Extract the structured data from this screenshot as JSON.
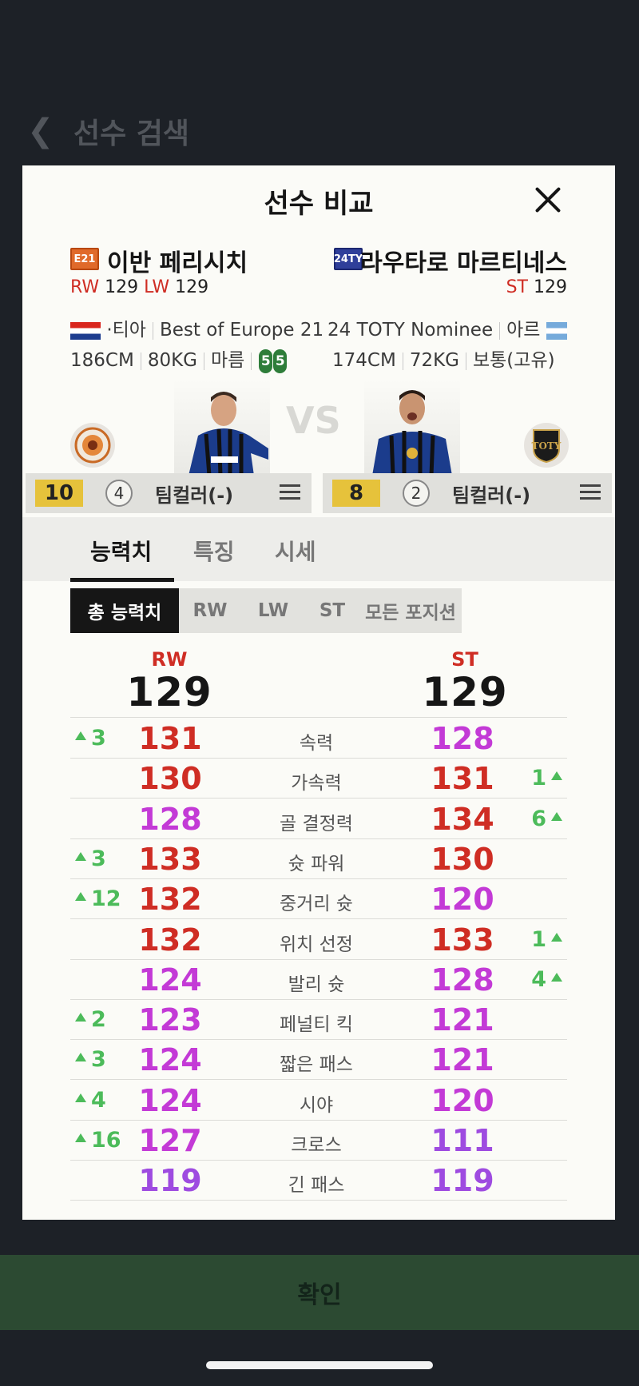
{
  "background": {
    "back_icon": "chevron-left-icon",
    "title": "선수 검색",
    "confirm_label": "확인"
  },
  "modal": {
    "title": "선수 비교",
    "close_icon": "close-icon",
    "vs": "VS"
  },
  "left_player": {
    "season_badge": "E21",
    "name": "이반 페리시치",
    "positions": [
      {
        "pos": "RW",
        "ovr": "129"
      },
      {
        "pos": "LW",
        "ovr": "129"
      }
    ],
    "nation_suffix": "·티아",
    "season_name": "Best of Europe 21",
    "height": "186CM",
    "weight": "80KG",
    "body_type": "마름",
    "skill_moves": [
      "5",
      "5"
    ],
    "grade": "10",
    "enhance": "4",
    "team_color": "팀컬러(-)"
  },
  "right_player": {
    "season_badge": "24TY",
    "name": "라우타로 마르티네스",
    "positions": [
      {
        "pos": "ST",
        "ovr": "129"
      }
    ],
    "season_name": "24 TOTY Nominee",
    "nation_prefix": "아르",
    "height": "174CM",
    "weight": "72KG",
    "body_type": "보통(고유)",
    "grade": "8",
    "enhance": "2",
    "team_color": "팀컬러(-)"
  },
  "tabs": [
    "능력치",
    "특징",
    "시세"
  ],
  "segments": [
    "총 능력치",
    "RW",
    "LW",
    "ST",
    "모든 포지션"
  ],
  "overall": {
    "left_pos": "RW",
    "left_val": "129",
    "right_pos": "ST",
    "right_val": "129"
  },
  "stats": [
    {
      "name": "속력",
      "left": "131",
      "right": "128",
      "left_diff": "3",
      "right_diff": "",
      "lc": "red",
      "rc": "mag"
    },
    {
      "name": "가속력",
      "left": "130",
      "right": "131",
      "left_diff": "",
      "right_diff": "1",
      "lc": "red",
      "rc": "red"
    },
    {
      "name": "골 결정력",
      "left": "128",
      "right": "134",
      "left_diff": "",
      "right_diff": "6",
      "lc": "mag",
      "rc": "red"
    },
    {
      "name": "슛 파워",
      "left": "133",
      "right": "130",
      "left_diff": "3",
      "right_diff": "",
      "lc": "red",
      "rc": "red"
    },
    {
      "name": "중거리 슛",
      "left": "132",
      "right": "120",
      "left_diff": "12",
      "right_diff": "",
      "lc": "red",
      "rc": "mag"
    },
    {
      "name": "위치 선정",
      "left": "132",
      "right": "133",
      "left_diff": "",
      "right_diff": "1",
      "lc": "red",
      "rc": "red"
    },
    {
      "name": "발리 슛",
      "left": "124",
      "right": "128",
      "left_diff": "",
      "right_diff": "4",
      "lc": "mag",
      "rc": "mag"
    },
    {
      "name": "페널티 킥",
      "left": "123",
      "right": "121",
      "left_diff": "2",
      "right_diff": "",
      "lc": "mag",
      "rc": "mag"
    },
    {
      "name": "짧은 패스",
      "left": "124",
      "right": "121",
      "left_diff": "3",
      "right_diff": "",
      "lc": "mag",
      "rc": "mag"
    },
    {
      "name": "시야",
      "left": "124",
      "right": "120",
      "left_diff": "4",
      "right_diff": "",
      "lc": "mag",
      "rc": "mag"
    },
    {
      "name": "크로스",
      "left": "127",
      "right": "111",
      "left_diff": "16",
      "right_diff": "",
      "lc": "mag",
      "rc": "pur"
    },
    {
      "name": "긴 패스",
      "left": "119",
      "right": "119",
      "left_diff": "",
      "right_diff": "",
      "lc": "pur",
      "rc": "pur"
    }
  ],
  "colors": {
    "red": "#cf2d24",
    "magenta": "#c33ad6",
    "purple": "#9e4be0",
    "up_green": "#4cbb5a",
    "confirm_bar": "#2c4a32",
    "grade_gold": "#e6c23b"
  }
}
